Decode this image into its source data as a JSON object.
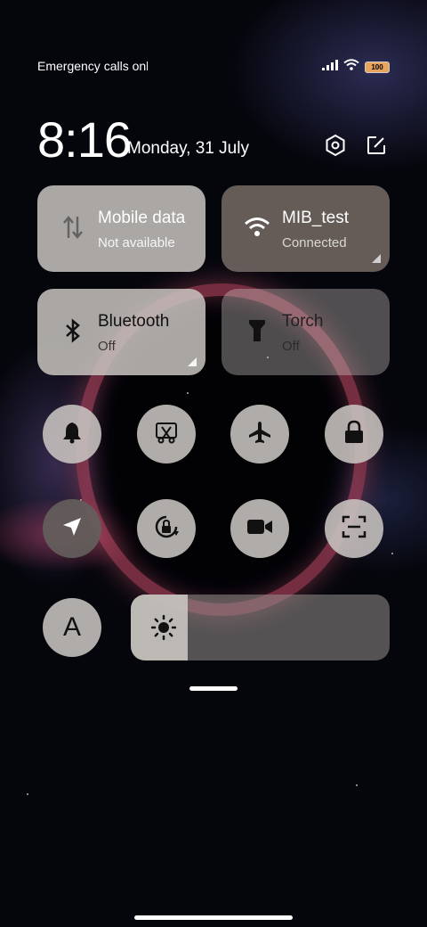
{
  "status_bar": {
    "carrier_text": "Emergency calls only",
    "battery": "100"
  },
  "header": {
    "time": "8:16",
    "date": "Monday, 31 July"
  },
  "tiles": {
    "mobile_data": {
      "name": "Mobile data",
      "status": "Not available"
    },
    "wifi": {
      "name": "MIB_test",
      "status": "Connected"
    },
    "bluetooth": {
      "name": "Bluetooth",
      "status": "Off"
    },
    "torch": {
      "name": "Torch",
      "status": "Off"
    }
  },
  "quick_toggles": {
    "row1": [
      "bell-icon",
      "screenshot-icon",
      "airplane-icon",
      "lock-icon"
    ],
    "row2": [
      "location-icon",
      "rotation-lock-icon",
      "video-camera-icon",
      "scan-icon"
    ]
  },
  "auto_brightness_label": "A",
  "brightness": {
    "level": 0.22
  },
  "colors": {
    "tile_light": "#c8c4c0",
    "tile_active": "#6e6460",
    "battery": "#e8a35c"
  }
}
